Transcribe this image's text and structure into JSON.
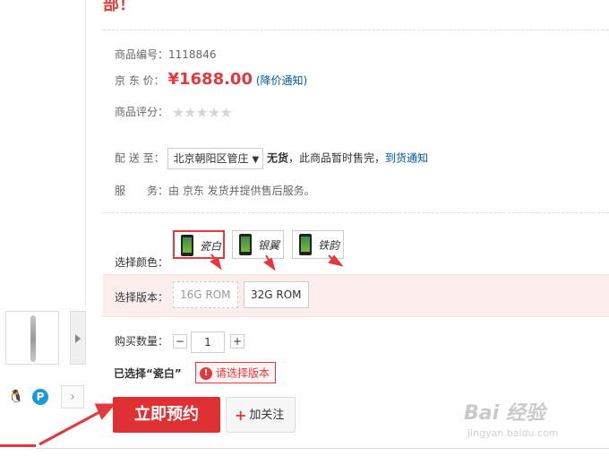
{
  "product": {
    "title_fragment": "部！",
    "number_label": "商品编号：",
    "number": "1118846",
    "price_label": "京 东 价：",
    "price": "¥1688.00",
    "price_alert": "(降价通知)",
    "rating_label": "商品评分：",
    "rating_stars": 0,
    "rating_max": 5
  },
  "delivery": {
    "label": "配 送 至：",
    "region": "北京朝阳区管庄",
    "stock_status": "无货",
    "stock_note": "，此商品暂时售完，",
    "notify_link": "到货通知"
  },
  "service": {
    "label": "服　　务：",
    "text": "由 京东 发货并提供售后服务。"
  },
  "color": {
    "label": "选择颜色：",
    "options": [
      "瓷白",
      "银翼",
      "铁韵"
    ],
    "selected_index": 0
  },
  "version": {
    "label": "选择版本：",
    "options": [
      "16G ROM",
      "32G ROM"
    ]
  },
  "quantity": {
    "label": "购买数量：",
    "minus": "−",
    "value": "1",
    "plus": "+"
  },
  "selection": {
    "selected_text": "已选择“瓷白”",
    "warning_icon": "!",
    "warning": "请选择版本"
  },
  "actions": {
    "reserve": "立即预约",
    "follow_plus": "+",
    "follow": "加关注"
  },
  "share": {
    "qq_icon": "🐧",
    "pp_icon": "P",
    "more_icon": "›"
  },
  "watermark": {
    "main": "Bai 经验",
    "sub": "jingyan.baidu.com"
  },
  "colors": {
    "accent": "#e4393c",
    "link": "#005aa0",
    "version_band": "#fdeeee"
  }
}
